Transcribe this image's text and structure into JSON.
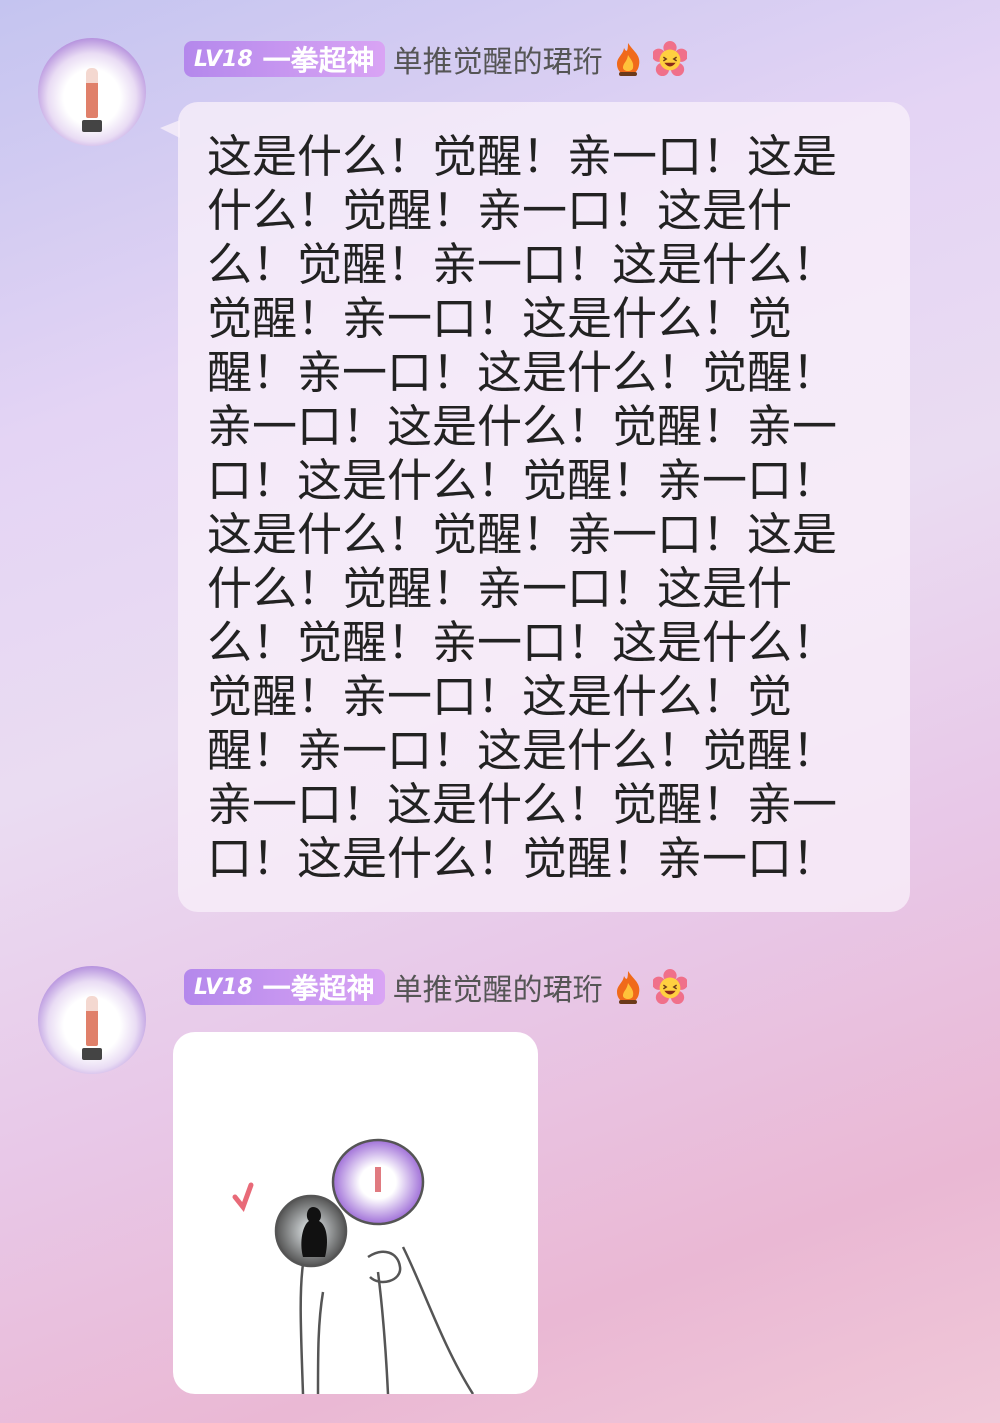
{
  "messages": [
    {
      "sender": {
        "level": "LV18",
        "title": "一拳超神",
        "name": "单推觉醒的珺珩",
        "emojis": [
          "fire-icon",
          "flower-laughing-icon"
        ]
      },
      "type": "text",
      "text": "这是什么！觉醒！亲一口！这是什么！觉醒！亲一口！这是什么！觉醒！亲一口！这是什么！觉醒！亲一口！这是什么！觉醒！亲一口！这是什么！觉醒！亲一口！这是什么！觉醒！亲一口！这是什么！觉醒！亲一口！这是什么！觉醒！亲一口！这是什么！觉醒！亲一口！这是什么！觉醒！亲一口！这是什么！觉醒！亲一口！这是什么！觉醒！亲一口！这是什么！觉醒！亲一口！这是什么！觉醒！亲一口！这是什么！觉醒！亲一口！"
    },
    {
      "sender": {
        "level": "LV18",
        "title": "一拳超神",
        "name": "单推觉醒的珺珩",
        "emojis": [
          "fire-icon",
          "flower-laughing-icon"
        ]
      },
      "type": "image"
    }
  ],
  "colors": {
    "badge_start": "#b488ec",
    "badge_end": "#d9a4f4",
    "heart": "#e86a78"
  }
}
